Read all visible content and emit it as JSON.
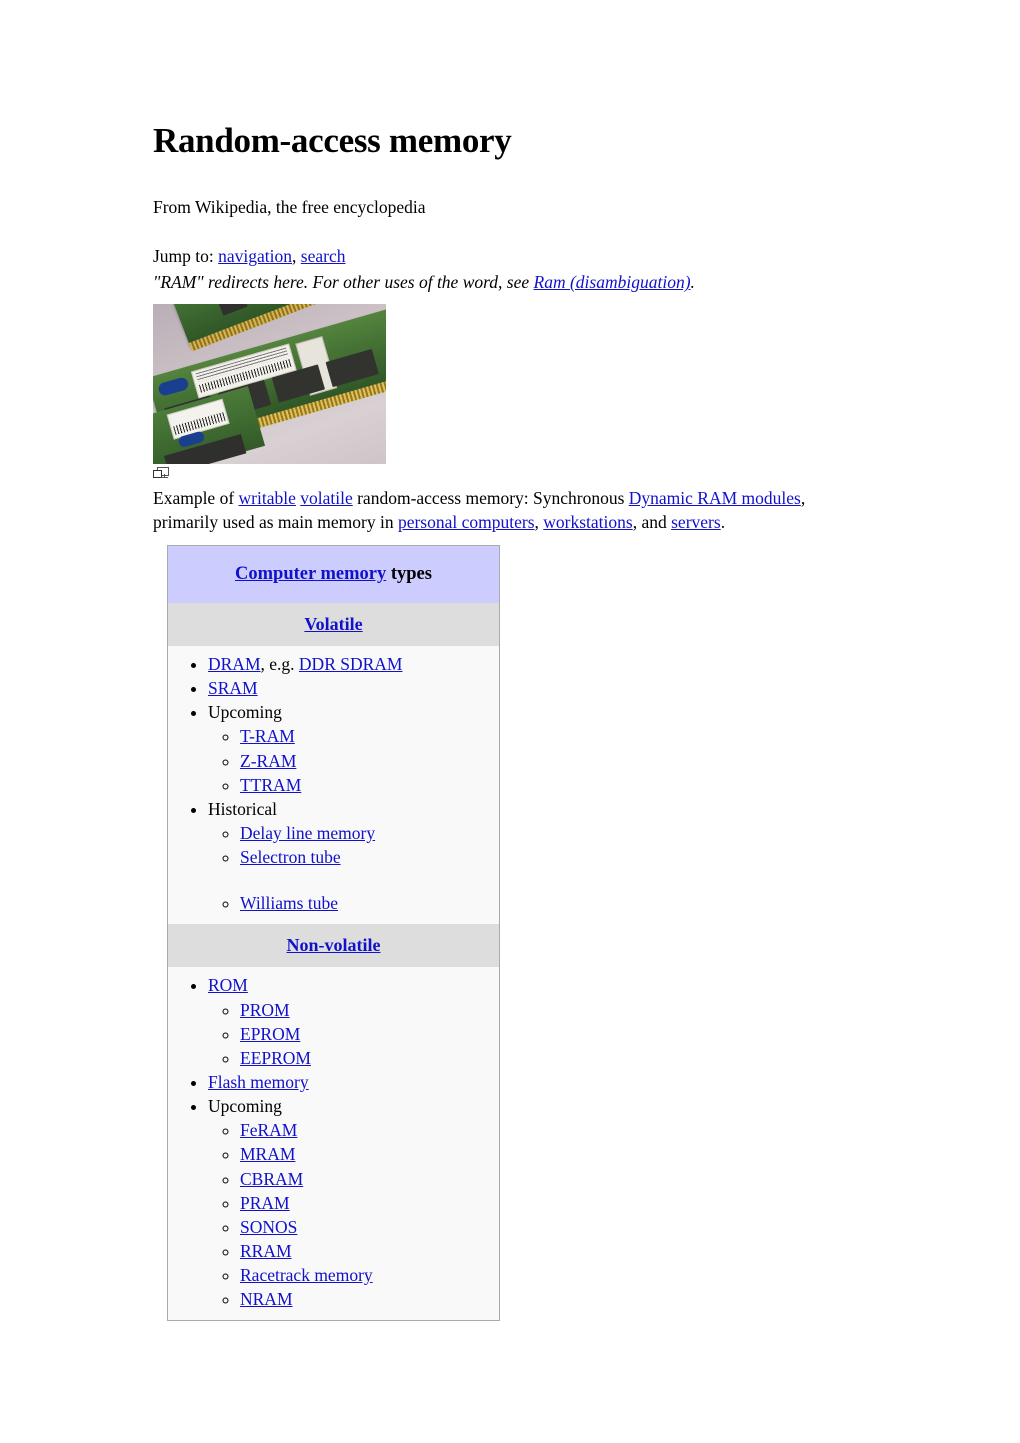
{
  "article": {
    "title": "Random-access memory",
    "tagline": "From Wikipedia, the free encyclopedia",
    "jump_prefix": "Jump to: ",
    "jump_nav": "navigation",
    "jump_sep": ", ",
    "jump_search": "search",
    "redirect_note_before": "\"RAM\" redirects here. For other uses of the word, see ",
    "redirect_note_link": "Ram (disambiguation)",
    "redirect_note_after": "."
  },
  "figure": {
    "magnify_icon": "magnify-icon",
    "caption": {
      "p1": "Example of ",
      "link_writable": "writable",
      "sp1": " ",
      "link_volatile": "volatile",
      "p2": " random-access memory: Synchronous ",
      "link_dram_modules": "Dynamic RAM modules",
      "p3": ", primarily used as main memory in ",
      "link_personal_computers": "personal computers",
      "p4": ", ",
      "link_workstations": "workstations",
      "p5": ", and ",
      "link_servers": "servers",
      "p6": "."
    }
  },
  "infobox": {
    "header_link": "Computer memory",
    "header_suffix": " types",
    "sections": [
      {
        "heading": "Volatile",
        "items": [
          {
            "type": "link",
            "label": "DRAM",
            "trailing_text": ", e.g. ",
            "trailing_link": "DDR SDRAM"
          },
          {
            "type": "link",
            "label": "SRAM"
          },
          {
            "type": "group",
            "label": "Upcoming",
            "children": [
              {
                "type": "link",
                "label": "T-RAM"
              },
              {
                "type": "link",
                "label": "Z-RAM"
              },
              {
                "type": "link",
                "label": "TTRAM"
              }
            ]
          },
          {
            "type": "group",
            "label": "Historical",
            "children": [
              {
                "type": "link",
                "label": "Delay line memory"
              },
              {
                "type": "link",
                "label": "Selectron tube"
              },
              {
                "type": "blank",
                "label": ""
              },
              {
                "type": "link",
                "label": "Williams tube"
              }
            ]
          }
        ]
      },
      {
        "heading": "Non-volatile",
        "items": [
          {
            "type": "link-group",
            "label": "ROM",
            "children": [
              {
                "type": "link",
                "label": "PROM"
              },
              {
                "type": "link",
                "label": "EPROM"
              },
              {
                "type": "link",
                "label": "EEPROM"
              }
            ]
          },
          {
            "type": "link",
            "label": "Flash memory"
          },
          {
            "type": "group",
            "label": "Upcoming",
            "children": [
              {
                "type": "link",
                "label": "FeRAM"
              },
              {
                "type": "link",
                "label": "MRAM"
              },
              {
                "type": "link",
                "label": "CBRAM"
              },
              {
                "type": "link",
                "label": "PRAM"
              },
              {
                "type": "link",
                "label": "SONOS"
              },
              {
                "type": "link",
                "label": "RRAM"
              },
              {
                "type": "link",
                "label": "Racetrack memory"
              },
              {
                "type": "link",
                "label": "NRAM"
              }
            ]
          }
        ]
      }
    ]
  },
  "colors": {
    "link": "#1111cc",
    "header_bg": "#ccccff",
    "subheader_bg": "#dddddd",
    "body_bg": "#f9f9f9",
    "border": "#aaaaaa",
    "page_bg": "#ffffff"
  }
}
